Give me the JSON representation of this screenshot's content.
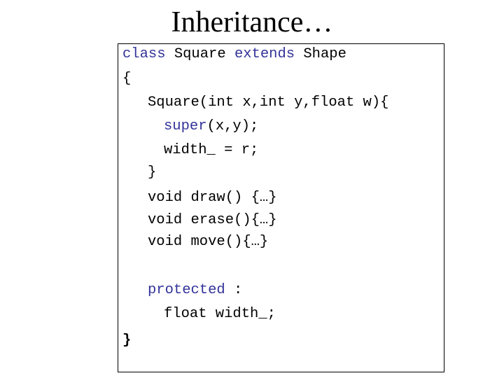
{
  "slide": {
    "title": "Inheritance…"
  },
  "code": {
    "keyword_color": "#333399",
    "lines": [
      {
        "parts": [
          {
            "text": "class",
            "kw": true
          },
          {
            "text": " Square "
          },
          {
            "text": "extends",
            "kw": true
          },
          {
            "text": " Shape"
          }
        ]
      },
      {
        "parts": [
          {
            "text": "{"
          }
        ]
      },
      {
        "parts": [
          {
            "text": "Square(int x,int y,float w){"
          }
        ]
      },
      {
        "parts": [
          {
            "text": "super",
            "kw": true
          },
          {
            "text": "(x,y);"
          }
        ]
      },
      {
        "parts": [
          {
            "text": "width_ = r;"
          }
        ]
      },
      {
        "parts": [
          {
            "text": "}"
          }
        ]
      },
      {
        "parts": [
          {
            "text": "void draw() {…}"
          }
        ]
      },
      {
        "parts": [
          {
            "text": "void erase(){…}"
          }
        ]
      },
      {
        "parts": [
          {
            "text": "void move(){…}"
          }
        ]
      },
      {
        "parts": [
          {
            "text": "protected",
            "kw": true
          },
          {
            "text": " :"
          }
        ]
      },
      {
        "parts": [
          {
            "text": "float width_;"
          }
        ]
      },
      {
        "parts": [
          {
            "text": "}"
          }
        ]
      }
    ]
  }
}
